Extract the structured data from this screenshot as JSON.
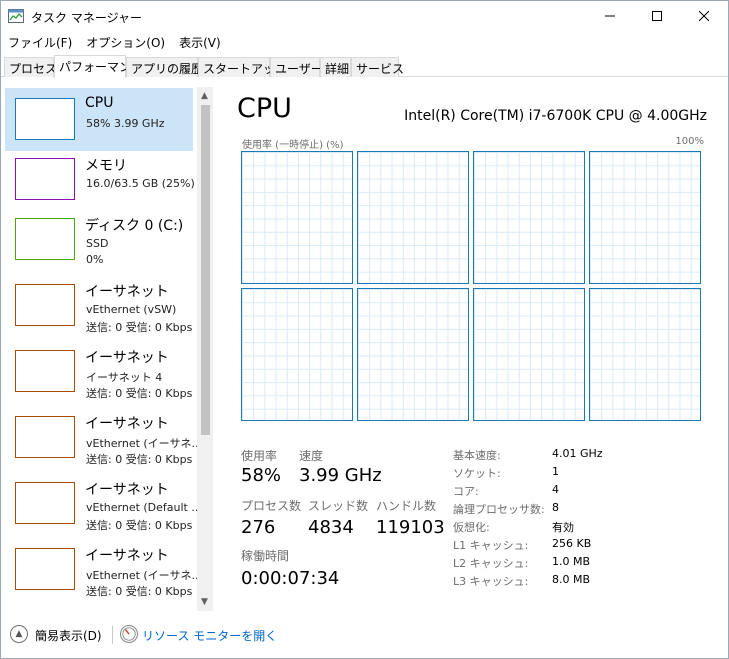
{
  "window": {
    "title": "タスク マネージャー",
    "controls": {
      "minimize": "—",
      "maximize": "☐",
      "close": "✕"
    }
  },
  "menu": [
    "ファイル(F)",
    "オプション(O)",
    "表示(V)"
  ],
  "tabs": [
    "プロセス",
    "パフォーマンス",
    "アプリの履歴",
    "スタートアップ",
    "ユーザー",
    "詳細",
    "サービス"
  ],
  "active_tab": "パフォーマンス",
  "sidebar": {
    "items": [
      {
        "title": "CPU",
        "line1": "58%  3.99 GHz",
        "line2": "",
        "color": "#1779ba",
        "selected": true
      },
      {
        "title": "メモリ",
        "line1": "16.0/63.5 GB (25%)",
        "line2": "",
        "color": "#8b12ae",
        "selected": false
      },
      {
        "title": "ディスク 0 (C:)",
        "line1": "SSD",
        "line2": "0%",
        "color": "#4da60c",
        "selected": false
      },
      {
        "title": "イーサネット",
        "line1": "vEthernet (vSW)",
        "line2": "送信: 0 受信: 0 Kbps",
        "color": "#a74f01",
        "selected": false
      },
      {
        "title": "イーサネット",
        "line1": "イーサネット 4",
        "line2": "送信: 0 受信: 0 Kbps",
        "color": "#a74f01",
        "selected": false
      },
      {
        "title": "イーサネット",
        "line1": "vEthernet (イーサネ...",
        "line2": "送信: 0 受信: 0 Kbps",
        "color": "#a74f01",
        "selected": false
      },
      {
        "title": "イーサネット",
        "line1": "vEthernet (Default ...",
        "line2": "送信: 0 受信: 0 Kbps",
        "color": "#a74f01",
        "selected": false
      },
      {
        "title": "イーサネット",
        "line1": "vEthernet (イーサネ...",
        "line2": "送信: 0 受信: 0 Kbps",
        "color": "#a74f01",
        "selected": false
      }
    ]
  },
  "cpu": {
    "heading": "CPU",
    "model": "Intel(R) Core(TM) i7-6700K CPU @ 4.00GHz",
    "graph_caption": "使用率 (一時停止) (%)",
    "graph_max": "100%",
    "core_count": 8,
    "stats": {
      "usage_label": "使用率",
      "usage_value": "58%",
      "speed_label": "速度",
      "speed_value": "3.99 GHz",
      "processes_label": "プロセス数",
      "processes_value": "276",
      "threads_label": "スレッド数",
      "threads_value": "4834",
      "handles_label": "ハンドル数",
      "handles_value": "119103",
      "uptime_label": "稼働時間",
      "uptime_value": "0:00:07:34"
    },
    "specs": [
      {
        "key": "基本速度:",
        "value": "4.01 GHz"
      },
      {
        "key": "ソケット:",
        "value": "1"
      },
      {
        "key": "コア:",
        "value": "4"
      },
      {
        "key": "論理プロセッサ数:",
        "value": "8"
      },
      {
        "key": "仮想化:",
        "value": "有効"
      },
      {
        "key": "L1 キャッシュ:",
        "value": "256 KB"
      },
      {
        "key": "L2 キャッシュ:",
        "value": "1.0 MB"
      },
      {
        "key": "L3 キャッシュ:",
        "value": "8.0 MB"
      }
    ]
  },
  "footer": {
    "fewer_details": "簡易表示(D)",
    "resource_monitor": "リソース モニターを開く"
  },
  "icons": {
    "app": "task-manager-icon",
    "fewer": "chevron-up-circle-icon",
    "resmon": "resource-monitor-icon"
  },
  "colors": {
    "cpu": "#1779ba",
    "memory": "#8b12ae",
    "disk": "#4da60c",
    "ethernet": "#a74f01",
    "selection": "#cce4f7",
    "link": "#0066cc"
  }
}
